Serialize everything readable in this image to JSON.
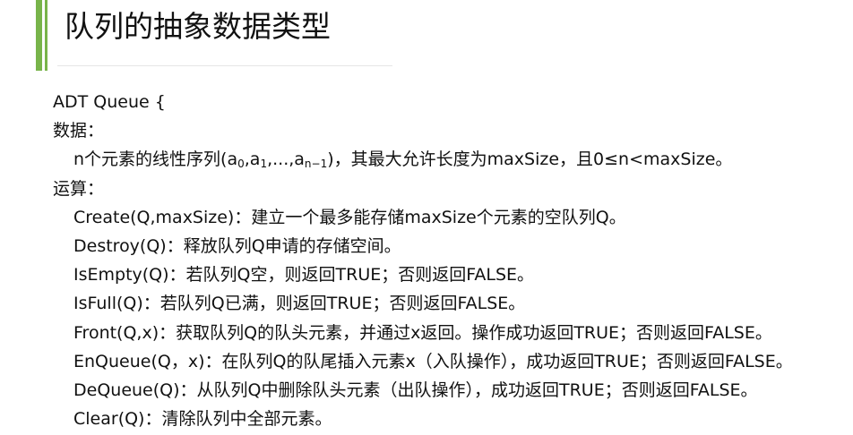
{
  "slide": {
    "title": "队列的抽象数据类型",
    "accent_color": "#78b44a"
  },
  "body": {
    "adt_header": "ADT Queue {",
    "data_label": "数据：",
    "data_desc": {
      "prefix": "n个元素的线性序列(a",
      "sub0": "0",
      "mid1": ",a",
      "sub1": "1",
      "mid2": ",...,a",
      "subn": "n−1",
      "suffix": ")，其最大允许长度为maxSize，且0≤n<maxSize。"
    },
    "ops_label": "运算：",
    "ops": [
      "Create(Q,maxSize)：建立一个最多能存储maxSize个元素的空队列Q。",
      "Destroy(Q)：释放队列Q申请的存储空间。",
      "IsEmpty(Q)：若队列Q空，则返回TRUE；否则返回FALSE。",
      "IsFull(Q)：若队列Q已满，则返回TRUE；否则返回FALSE。",
      "Front(Q,x)：获取队列Q的队头元素，并通过x返回。操作成功返回TRUE；否则返回FALSE。",
      "EnQueue(Q，x)：在队列Q的队尾插入元素x（入队操作），成功返回TRUE；否则返回FALSE。",
      "DeQueue(Q)：从队列Q中删除队头元素（出队操作），成功返回TRUE；否则返回FALSE。",
      "Clear(Q)：清除队列中全部元素。"
    ]
  }
}
